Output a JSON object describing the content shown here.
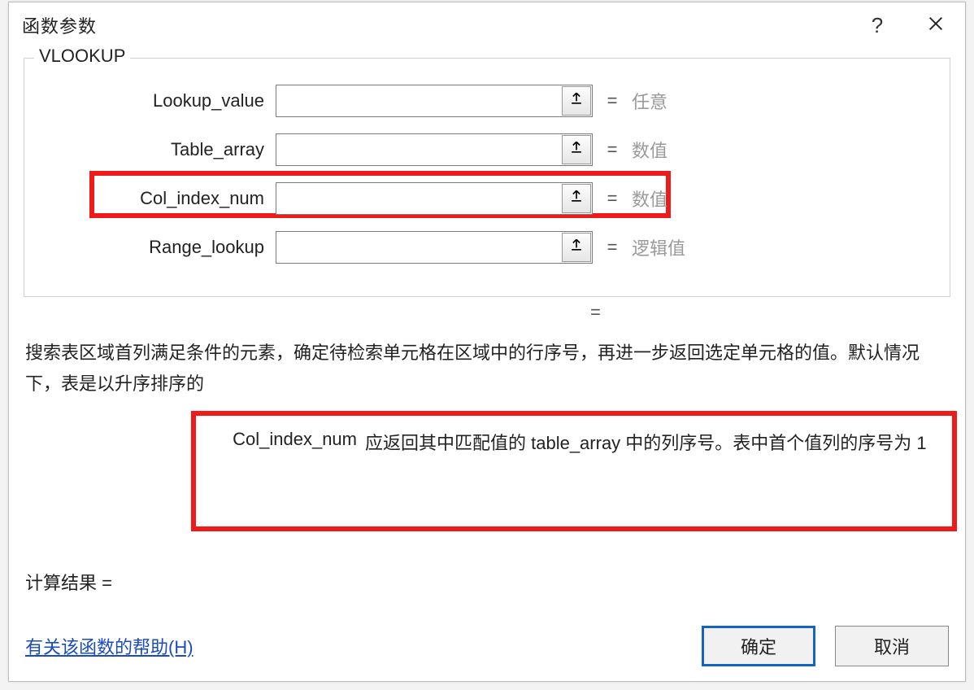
{
  "dialog": {
    "title": "函数参数",
    "help_icon_label": "?",
    "function_name": "VLOOKUP",
    "args": [
      {
        "name": "Lookup_value",
        "value": "",
        "hint": "任意"
      },
      {
        "name": "Table_array",
        "value": "",
        "hint": "数值"
      },
      {
        "name": "Col_index_num",
        "value": "",
        "hint": "数值"
      },
      {
        "name": "Range_lookup",
        "value": "",
        "hint": "逻辑值"
      }
    ],
    "result_equals": "=",
    "description_main": "搜索表区域首列满足条件的元素，确定待检索单元格在区域中的行序号，再进一步返回选定单元格的值。默认情况下，表是以升序排序的",
    "active_arg": {
      "name": "Col_index_num",
      "desc": "应返回其中匹配值的 table_array 中的列序号。表中首个值列的序号为 1"
    },
    "calc_result_label": "计算结果 =",
    "calc_result_value": "",
    "help_link": "有关该函数的帮助(H)",
    "ok_label": "确定",
    "cancel_label": "取消"
  }
}
